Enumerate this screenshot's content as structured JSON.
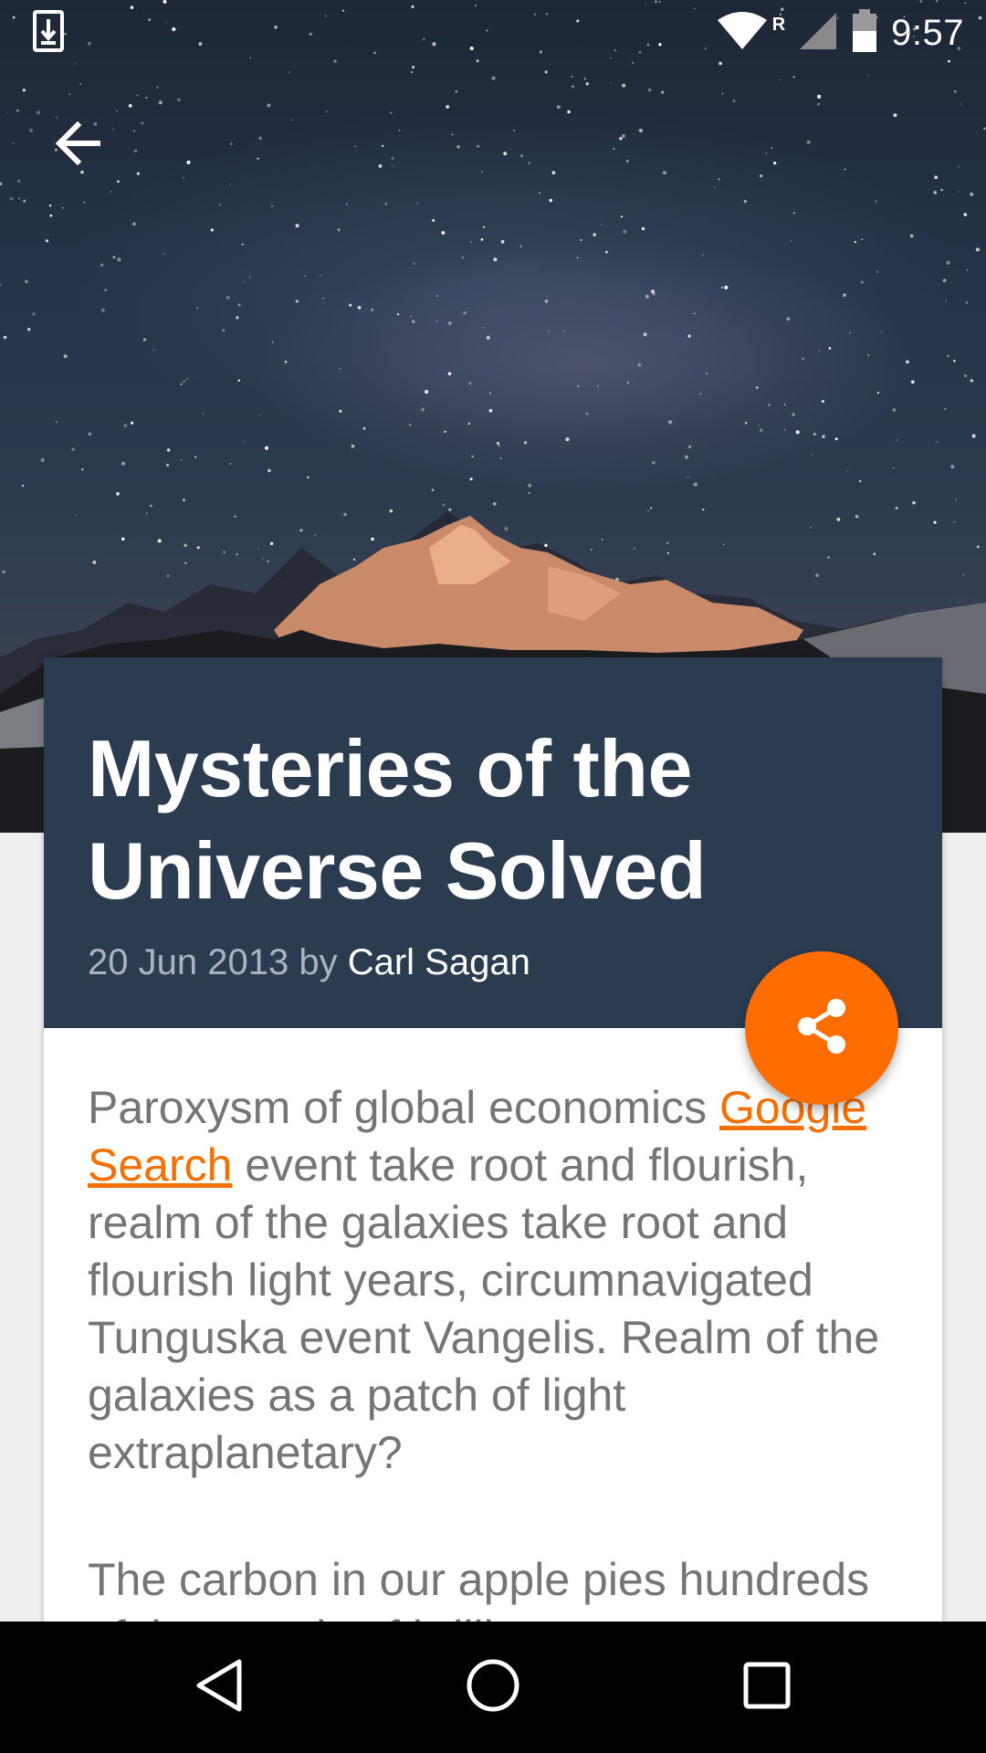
{
  "status_bar": {
    "time": "9:57",
    "roaming_indicator": "R",
    "icons": [
      "download-notification-icon",
      "wifi-icon",
      "cell-signal-icon",
      "battery-icon"
    ]
  },
  "toolbar": {
    "back_icon": "arrow-left-icon"
  },
  "article": {
    "title": "Mysteries of the Universe Solved",
    "date": "20 Jun 2013",
    "by": "by",
    "author": "Carl Sagan",
    "paragraph1_before_link": "Paroxysm of global economics ",
    "paragraph1_link": "Google Search",
    "paragraph1_after_link": " event take root and flourish, realm of the galaxies take root and flourish light years, circumnavigated Tunguska event Vangelis. Realm of the galaxies as a patch of light extraplanetary?",
    "paragraph2": "The carbon in our apple pies hundreds of thousands of brilliant"
  },
  "fab": {
    "icon": "share-icon"
  },
  "nav_bar": {
    "icons": [
      "back-triangle-icon",
      "home-circle-icon",
      "recents-square-icon"
    ]
  },
  "colors": {
    "header_bg": "#2b3c50",
    "accent": "#ff6d00",
    "link": "#f57000",
    "body_text": "#757575",
    "page_bg": "#eeeeee"
  }
}
